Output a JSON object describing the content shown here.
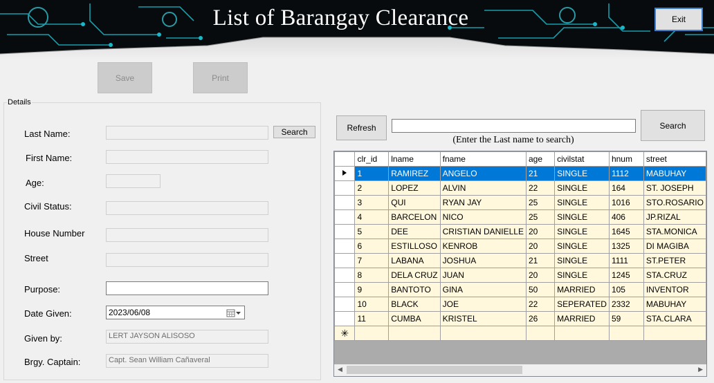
{
  "header": {
    "title": "List of Barangay Clearance",
    "exit_label": "Exit"
  },
  "actions": {
    "save_label": "Save",
    "print_label": "Print"
  },
  "details": {
    "group_label": "Details",
    "search_label": "Search",
    "labels": {
      "last_name": "Last Name:",
      "first_name": "First Name:",
      "age": "Age:",
      "civil_status": "Civil Status:",
      "house_number": "House Number",
      "street": "Street",
      "purpose": "Purpose:",
      "date_given": "Date Given:",
      "given_by": "Given by:",
      "brgy_captain": "Brgy. Captain:"
    },
    "values": {
      "last_name": "",
      "first_name": "",
      "age": "",
      "civil_status": "",
      "house_number": "",
      "street": "",
      "purpose": "",
      "date_given": "2023/06/08",
      "given_by": "LERT JAYSON ALISOSO",
      "brgy_captain": "Capt. Sean William Cañaveral"
    }
  },
  "search_panel": {
    "refresh_label": "Refresh",
    "search_label": "Search",
    "search_value": "",
    "hint": "(Enter the Last name to search)"
  },
  "grid": {
    "columns": [
      "clr_id",
      "lname",
      "fname",
      "age",
      "civilstat",
      "hnum",
      "street"
    ],
    "rows": [
      [
        "1",
        "RAMIREZ",
        "ANGELO",
        "21",
        "SINGLE",
        "1112",
        "MABUHAY"
      ],
      [
        "2",
        "LOPEZ",
        "ALVIN",
        "22",
        "SINGLE",
        "164",
        "ST. JOSEPH"
      ],
      [
        "3",
        "QUI",
        "RYAN JAY",
        "25",
        "SINGLE",
        "1016",
        "STO.ROSARIO"
      ],
      [
        "4",
        "BARCELON",
        "NICO",
        "25",
        "SINGLE",
        "406",
        "JP.RIZAL"
      ],
      [
        "5",
        "DEE",
        "CRISTIAN DANIELLE",
        "20",
        "SINGLE",
        "1645",
        "STA.MONICA"
      ],
      [
        "6",
        "ESTILLOSO",
        "KENROB",
        "20",
        "SINGLE",
        "1325",
        "DI MAGIBA"
      ],
      [
        "7",
        "LABANA",
        "JOSHUA",
        "21",
        "SINGLE",
        "1111",
        "ST.PETER"
      ],
      [
        "8",
        "DELA CRUZ",
        "JUAN",
        "20",
        "SINGLE",
        "1245",
        "STA.CRUZ"
      ],
      [
        "9",
        "BANTOTO",
        "GINA",
        "50",
        "MARRIED",
        "105",
        "INVENTOR"
      ],
      [
        "10",
        "BLACK",
        "JOE",
        "22",
        "SEPERATED",
        "2332",
        "MABUHAY"
      ],
      [
        "11",
        "CUMBA",
        "KRISTEL",
        "26",
        "MARRIED",
        "59",
        "STA.CLARA"
      ]
    ],
    "selected_row": 0,
    "colors": {
      "selection": "#0078d7",
      "row_bg": "#fff8dc"
    }
  }
}
